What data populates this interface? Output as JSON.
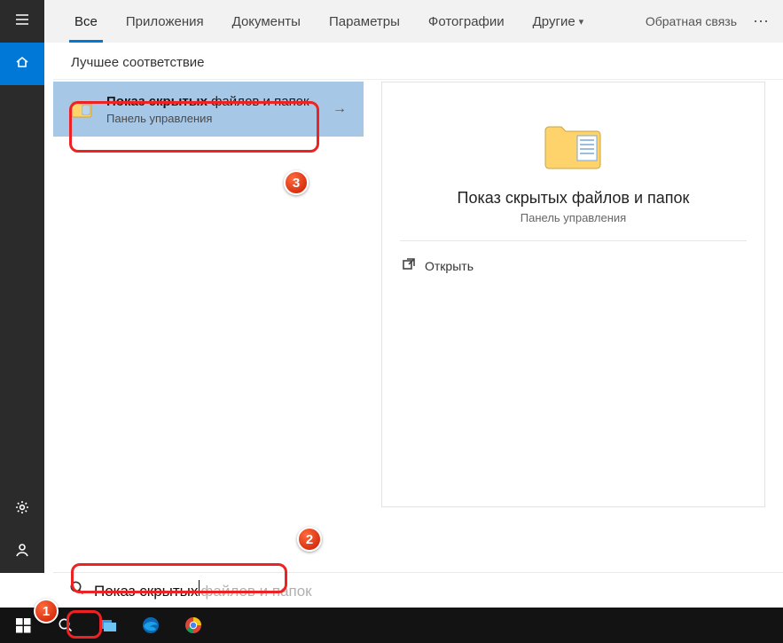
{
  "top_tabs": {
    "all": "Все",
    "apps": "Приложения",
    "documents": "Документы",
    "settings": "Параметры",
    "photos": "Фотографии",
    "more": "Другие"
  },
  "feedback_label": "Обратная связь",
  "section_header": "Лучшее соответствие",
  "result": {
    "title_bold": "Показ скрытых",
    "title_rest": " файлов и папок",
    "sub": "Панель управления"
  },
  "preview": {
    "title": "Показ скрытых файлов и папок",
    "sub": "Панель управления",
    "open_label": "Открыть"
  },
  "search": {
    "typed": "Показ скрытых",
    "suggestion": " файлов и папок"
  },
  "icons": {
    "hamburger": "hamburger-icon",
    "home": "home-icon",
    "gear": "gear-icon",
    "person": "person-icon",
    "search": "search-icon",
    "folder": "folder-icon",
    "arrow_right": "arrow-right-icon",
    "open": "open-icon",
    "chevron_down": "chevron-down-icon",
    "ellipsis": "ellipsis-icon",
    "windows": "windows-icon",
    "explorer": "file-explorer-icon",
    "edge": "edge-icon",
    "chrome": "chrome-icon"
  },
  "annotations": {
    "b1": "1",
    "b2": "2",
    "b3": "3"
  },
  "colors": {
    "accent": "#0078d7",
    "selection": "#a7c7e7",
    "annotation": "#e22",
    "taskbar": "#131313",
    "rail": "#2b2b2b"
  }
}
